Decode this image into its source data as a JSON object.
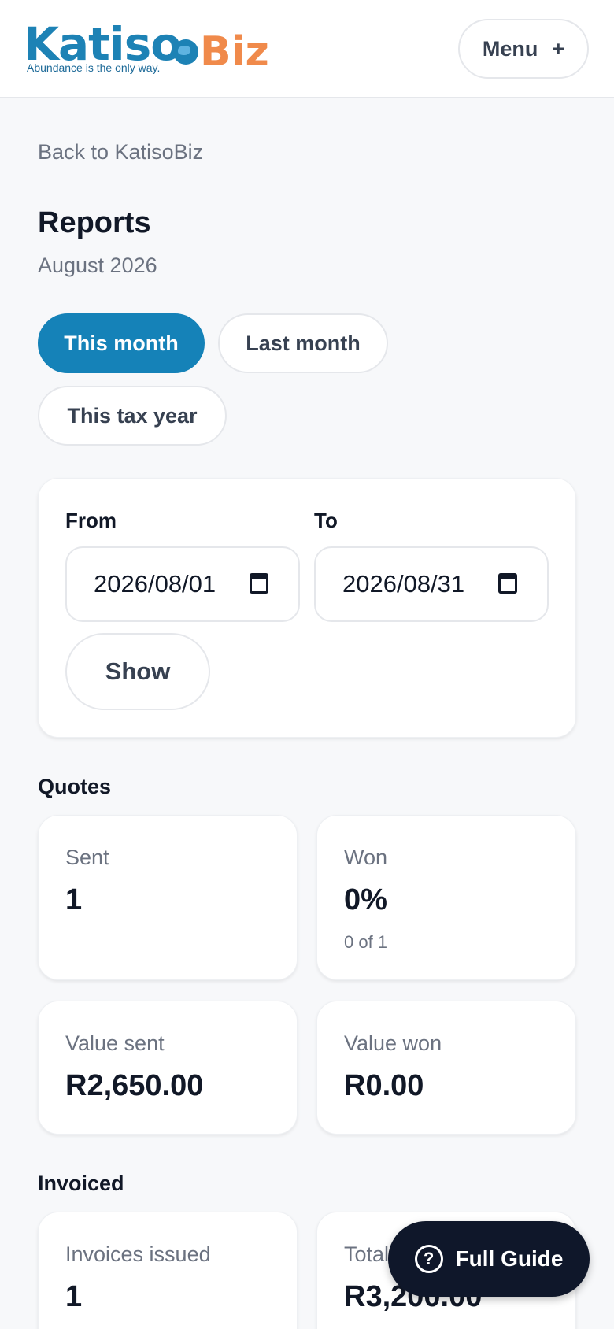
{
  "header": {
    "logo_main": "Katiso",
    "logo_accent": "Biz",
    "logo_tagline": "Abundance is the only way.",
    "menu_label": "Menu",
    "menu_icon": "+"
  },
  "nav": {
    "back_label": "Back to KatisoBiz"
  },
  "page": {
    "title": "Reports",
    "period": "August 2026"
  },
  "filters": [
    {
      "label": "This month",
      "active": true
    },
    {
      "label": "Last month",
      "active": false
    },
    {
      "label": "This tax year",
      "active": false
    }
  ],
  "range": {
    "from_label": "From",
    "from_value": "2026/08/01",
    "to_label": "To",
    "to_value": "2026/08/31",
    "show_label": "Show"
  },
  "quotes": {
    "title": "Quotes",
    "sent_label": "Sent",
    "sent_value": "1",
    "won_label": "Won",
    "won_value": "0%",
    "won_sub": "0 of 1",
    "value_sent_label": "Value sent",
    "value_sent_value": "R2,650.00",
    "value_won_label": "Value won",
    "value_won_value": "R0.00"
  },
  "invoiced": {
    "title": "Invoiced",
    "issued_label": "Invoices issued",
    "issued_value": "1",
    "total_label": "Total",
    "total_value": "R3,200.00"
  },
  "guide": {
    "label": "Full Guide",
    "icon": "?"
  },
  "colors": {
    "accent": "#1582b8",
    "brand_orange": "#f08a4b",
    "dark": "#0f172a"
  }
}
